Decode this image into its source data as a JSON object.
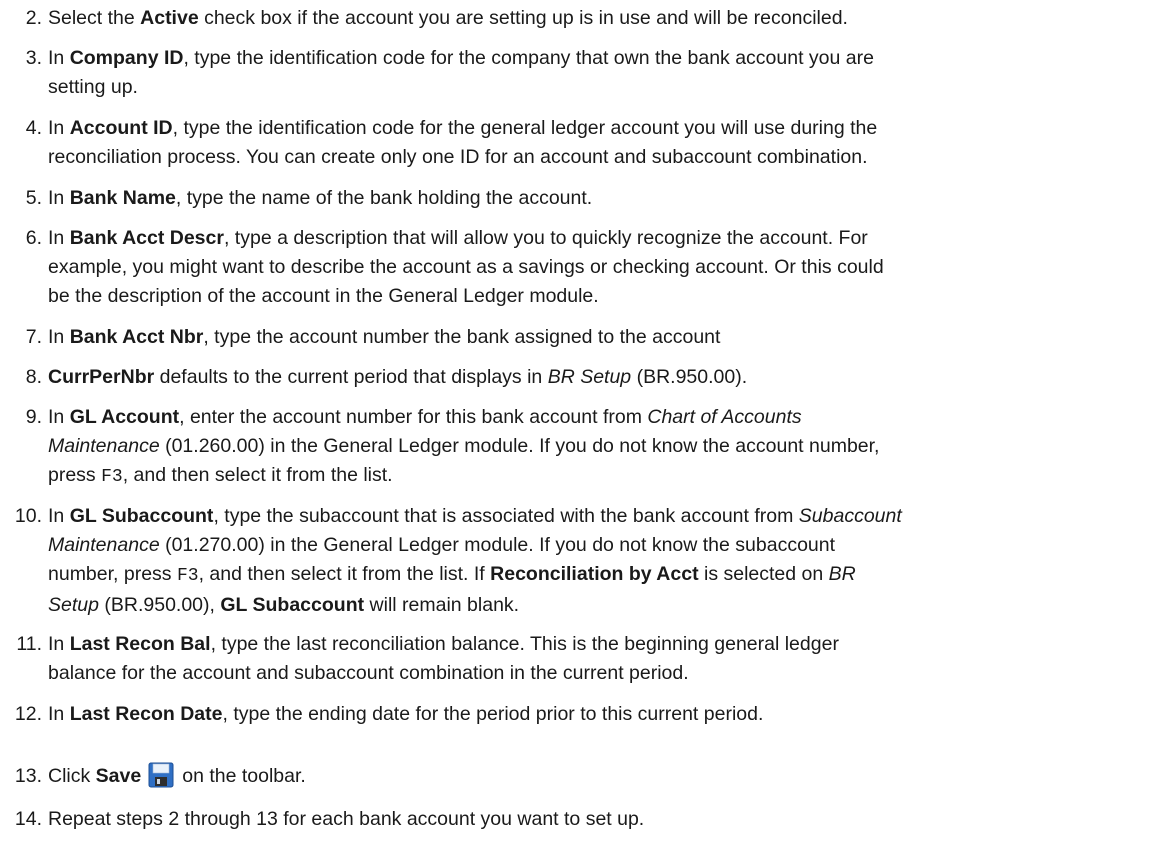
{
  "steps": [
    {
      "num": "2.",
      "parts": [
        "Select the ",
        "Active",
        " check box if the account you are setting up is in use and will be reconciled."
      ]
    },
    {
      "num": "3.",
      "parts": [
        "In ",
        "Company ID",
        ", type the identification code for the company that own the bank account you are",
        "setting up."
      ]
    },
    {
      "num": "4.",
      "parts": [
        "In ",
        "Account ID",
        ", type the identification code for the general ledger account you will use during the",
        "reconciliation process. You can create only one ID for an account and subaccount combination."
      ]
    },
    {
      "num": "5.",
      "parts": [
        "In ",
        "Bank Name",
        ", type the name of the bank holding the account."
      ]
    },
    {
      "num": "6.",
      "parts": [
        "In ",
        "Bank Acct Descr",
        ", type a description that will allow you to quickly recognize the account. For",
        "example, you might want to describe the account as a savings or checking account. Or this could",
        "be the description of the account in the General Ledger module."
      ]
    },
    {
      "num": "7.",
      "parts": [
        "In ",
        "Bank Acct Nbr",
        ", type the account number the bank assigned to the account"
      ]
    },
    {
      "num": "8.",
      "parts": [
        "CurrPerNbr",
        " defaults to the current period that displays in ",
        "BR Setup",
        " (BR.950.00)."
      ]
    },
    {
      "num": "9.",
      "parts": [
        "In ",
        "GL Account",
        ", enter the account number for this bank account from ",
        "Chart of Accounts",
        "Maintenance",
        " (01.260.00) in the General Ledger module. If you do not know the account number,",
        "press ",
        "F3",
        ", and then select it from the list."
      ]
    },
    {
      "num": "10.",
      "parts": [
        "In ",
        "GL Subaccount",
        ", type the subaccount that is associated with the bank account from ",
        "Subaccount",
        "Maintenance",
        " (01.270.00) in the General Ledger module. If you do not know the subaccount",
        "number, press ",
        "F3",
        ", and then select it from the list. If ",
        "Reconciliation by Acct",
        " is selected on ",
        "BR",
        "Setup",
        " (BR.950.00), ",
        "GL Subaccount",
        " will remain blank."
      ]
    },
    {
      "num": "11.",
      "parts": [
        "In ",
        "Last Recon Bal",
        ", type the last reconciliation balance. This is the beginning general ledger",
        "balance for the account and subaccount combination in the current period."
      ]
    },
    {
      "num": "12.",
      "parts": [
        "In ",
        "Last Recon Date",
        ", type the ending date for the period prior to this current period."
      ]
    },
    {
      "num": "13.",
      "parts": [
        "Click ",
        "Save",
        "on the toolbar."
      ]
    },
    {
      "num": "14.",
      "parts": [
        "Repeat steps 2 through 13 for each bank account you want to set up."
      ]
    }
  ],
  "icons": {
    "save": "save-floppy-icon"
  }
}
